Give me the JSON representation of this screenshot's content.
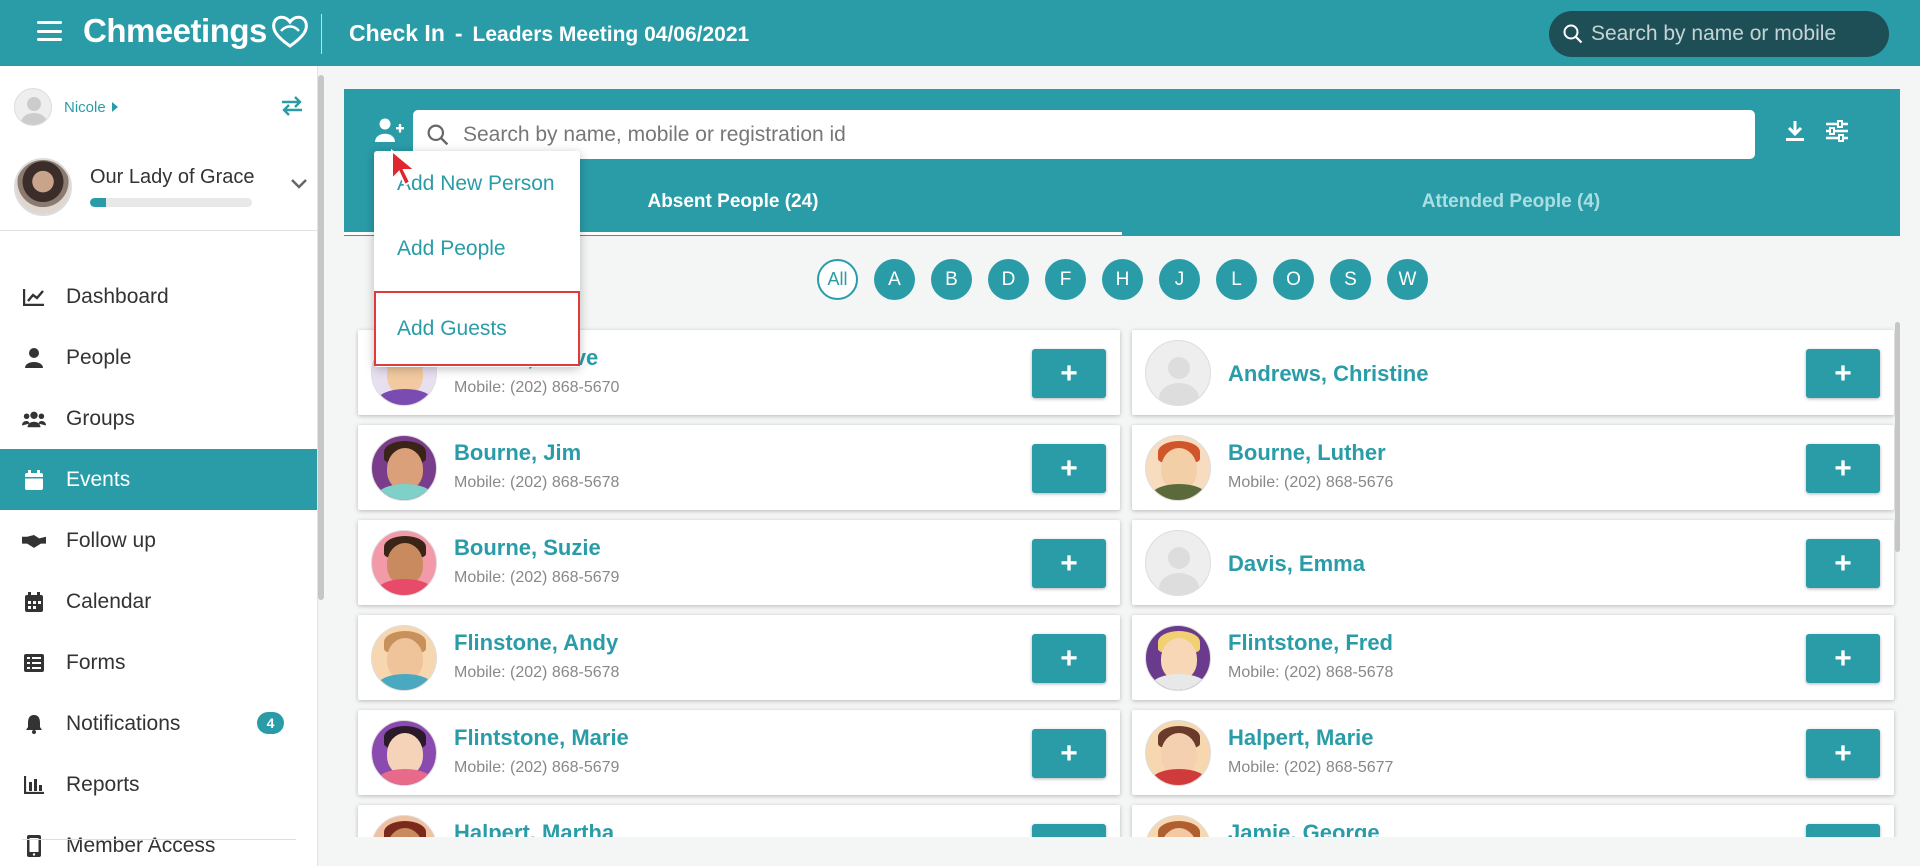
{
  "topbar": {
    "logo": "Chmeetings",
    "title": "Check In",
    "separator": "-",
    "event": "Leaders Meeting 04/06/2021",
    "search_placeholder": "Search by name or mobile"
  },
  "sidebar": {
    "user_name": "Nicole",
    "church_name": "Our Lady of Grace",
    "church_progress": 0.1,
    "items": [
      {
        "label": "Dashboard",
        "icon": "chart-line-icon"
      },
      {
        "label": "People",
        "icon": "person-icon"
      },
      {
        "label": "Groups",
        "icon": "users-icon"
      },
      {
        "label": "Events",
        "icon": "calendar-icon",
        "active": true
      },
      {
        "label": "Follow up",
        "icon": "handshake-icon"
      },
      {
        "label": "Calendar",
        "icon": "calendar-grid-icon"
      },
      {
        "label": "Forms",
        "icon": "list-icon"
      },
      {
        "label": "Notifications",
        "icon": "bell-icon",
        "badge": "4"
      },
      {
        "label": "Reports",
        "icon": "bar-chart-icon"
      },
      {
        "label": "Member Access",
        "icon": "mobile-icon"
      }
    ]
  },
  "main": {
    "search_placeholder": "Search by name, mobile or registration id",
    "tabs": [
      {
        "label": "Absent People (24)"
      },
      {
        "label": "Attended People (4)"
      }
    ],
    "letters": [
      "All",
      "A",
      "B",
      "D",
      "F",
      "H",
      "J",
      "L",
      "O",
      "S",
      "W"
    ],
    "add_menu": [
      "Add New Person",
      "Add People",
      "Add Guests"
    ],
    "add_button_label": "+",
    "people": [
      {
        "name": "Adams, Steve",
        "mobile": "Mobile: (202) 868-5670",
        "face": "#f2c9a0",
        "hair": "#5a3a2a",
        "body": "#7a4bb0",
        "bg": "#e8e0f0"
      },
      {
        "name": "Andrews, Christine",
        "mobile": "",
        "blank": true
      },
      {
        "name": "Bourne, Jim",
        "mobile": "Mobile: (202) 868-5678",
        "face": "#d9a07a",
        "hair": "#3a2418",
        "body": "#7ed0c8",
        "bg": "#7a3d8c"
      },
      {
        "name": "Bourne, Luther",
        "mobile": "Mobile: (202) 868-5676",
        "face": "#f3cfa8",
        "hair": "#d0552a",
        "body": "#5a6a3a",
        "bg": "#f7dcc0"
      },
      {
        "name": "Bourne, Suzie",
        "mobile": "Mobile: (202) 868-5679",
        "face": "#c98a60",
        "hair": "#3a2418",
        "body": "#e84a6a",
        "bg": "#f29aa8"
      },
      {
        "name": "Davis, Emma",
        "mobile": "",
        "blank": true
      },
      {
        "name": "Flinstone, Andy",
        "mobile": "Mobile: (202) 868-5678",
        "face": "#f0c49a",
        "hair": "#c8905a",
        "body": "#4aa8c0",
        "bg": "#f7d7b0"
      },
      {
        "name": "Flintstone, Fred",
        "mobile": "Mobile: (202) 868-5678",
        "face": "#f7d7b5",
        "hair": "#f0d070",
        "body": "#e8e8e8",
        "bg": "#6a3a8c"
      },
      {
        "name": "Flintstone, Marie",
        "mobile": "Mobile: (202) 868-5679",
        "face": "#f5d3b8",
        "hair": "#2a1a2a",
        "body": "#e86a8a",
        "bg": "#8a4ab0"
      },
      {
        "name": "Halpert, Marie",
        "mobile": "Mobile: (202) 868-5677",
        "face": "#f5d0b0",
        "hair": "#6a3a2a",
        "body": "#d03a3a",
        "bg": "#f7d7b0"
      },
      {
        "name": "Halpert, Martha",
        "mobile": "",
        "face": "#c98a60",
        "hair": "#7a2a1a",
        "body": "#333333",
        "bg": "#f0c0a0"
      },
      {
        "name": "Jamie, George",
        "mobile": "",
        "face": "#f2c9a0",
        "hair": "#b06030",
        "body": "#3a6a9a",
        "bg": "#f7d7b0"
      }
    ]
  },
  "colors": {
    "primary": "#2a9ca8",
    "topbar_search": "#1e4f57",
    "highlight": "#e03a3a"
  }
}
